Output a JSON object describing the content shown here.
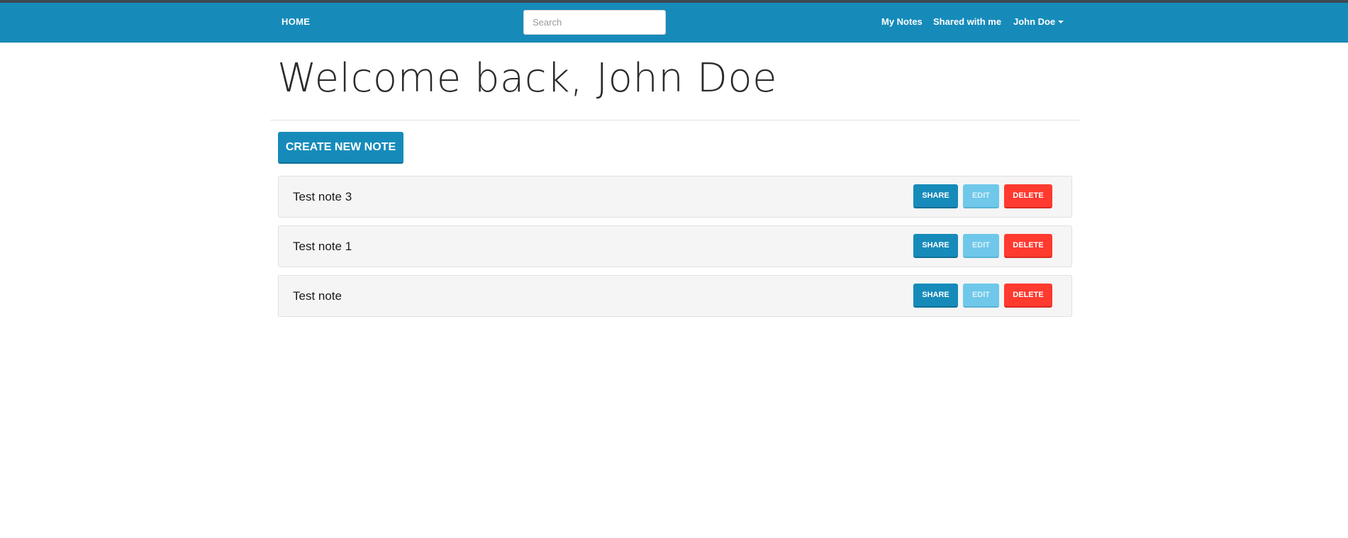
{
  "navbar": {
    "home_label": "HOME",
    "search_placeholder": "Search",
    "search_value": "",
    "my_notes_label": "My Notes",
    "shared_label": "Shared with me",
    "user_label": "John Doe",
    "background_color": "#168bba"
  },
  "main": {
    "welcome_heading": "Welcome back, John Doe",
    "create_button_label": "CREATE NEW NOTE"
  },
  "notes": [
    {
      "title": "Test note 3",
      "share_label": "SHARE",
      "edit_label": "EDIT",
      "delete_label": "DELETE"
    },
    {
      "title": "Test note 1",
      "share_label": "SHARE",
      "edit_label": "EDIT",
      "delete_label": "DELETE"
    },
    {
      "title": "Test note",
      "share_label": "SHARE",
      "edit_label": "EDIT",
      "delete_label": "DELETE"
    }
  ],
  "colors": {
    "primary": "#168bba",
    "edit": "#6fc8ea",
    "danger": "#ff3a2f"
  }
}
